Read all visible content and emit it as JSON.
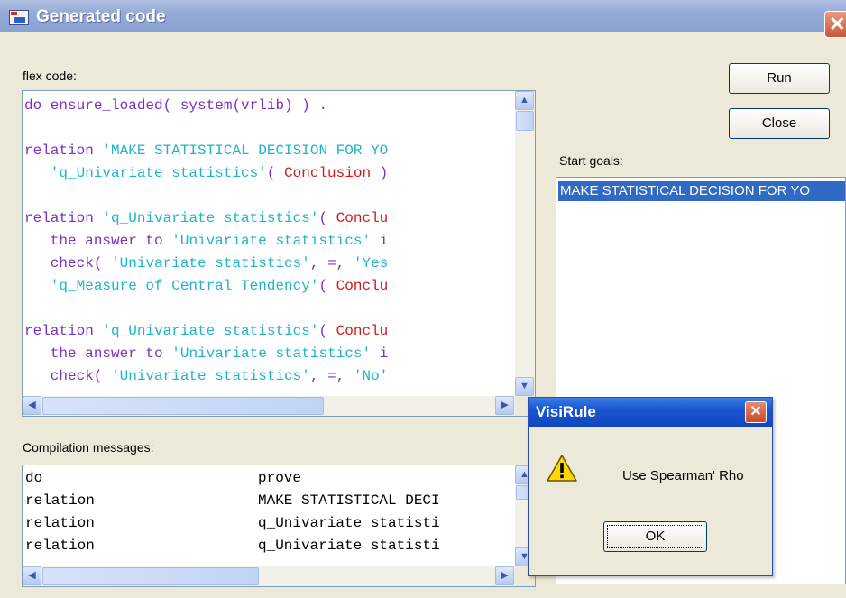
{
  "window": {
    "title": "Generated code",
    "close_glyph": "✕"
  },
  "labels": {
    "flex_code": "flex code:",
    "compilation_messages": "Compilation messages:",
    "start_goals": "Start goals:"
  },
  "buttons": {
    "run": "Run",
    "close": "Close"
  },
  "code_lines": [
    [
      {
        "t": "do ensure_loaded( system(vrlib) ) .",
        "c": "kw"
      }
    ],
    [],
    [
      {
        "t": "relation ",
        "c": "kw"
      },
      {
        "t": "'MAKE STATISTICAL DECISION FOR YO",
        "c": "str"
      }
    ],
    [
      {
        "t": "   'q_Univariate statistics'",
        "c": "str"
      },
      {
        "t": "( ",
        "c": "op"
      },
      {
        "t": "Conclusion",
        "c": "var"
      },
      {
        "t": " )",
        "c": "op"
      }
    ],
    [],
    [
      {
        "t": "relation ",
        "c": "kw"
      },
      {
        "t": "'q_Univariate statistics'",
        "c": "str"
      },
      {
        "t": "( ",
        "c": "op"
      },
      {
        "t": "Conclu",
        "c": "var"
      }
    ],
    [
      {
        "t": "   the answer to ",
        "c": "kw"
      },
      {
        "t": "'Univariate statistics'",
        "c": "str"
      },
      {
        "t": " i",
        "c": "kw"
      }
    ],
    [
      {
        "t": "   check( ",
        "c": "kw"
      },
      {
        "t": "'Univariate statistics'",
        "c": "str"
      },
      {
        "t": ", =, ",
        "c": "op"
      },
      {
        "t": "'Yes",
        "c": "str"
      }
    ],
    [
      {
        "t": "   'q_Measure of Central Tendency'",
        "c": "str"
      },
      {
        "t": "( ",
        "c": "op"
      },
      {
        "t": "Conclu",
        "c": "var"
      }
    ],
    [],
    [
      {
        "t": "relation ",
        "c": "kw"
      },
      {
        "t": "'q_Univariate statistics'",
        "c": "str"
      },
      {
        "t": "( ",
        "c": "op"
      },
      {
        "t": "Conclu",
        "c": "var"
      }
    ],
    [
      {
        "t": "   the answer to ",
        "c": "kw"
      },
      {
        "t": "'Univariate statistics'",
        "c": "str"
      },
      {
        "t": " i",
        "c": "kw"
      }
    ],
    [
      {
        "t": "   check( ",
        "c": "kw"
      },
      {
        "t": "'Univariate statistics'",
        "c": "str"
      },
      {
        "t": ", =, ",
        "c": "op"
      },
      {
        "t": "'No'",
        "c": "str"
      }
    ]
  ],
  "messages": [
    {
      "type": "do",
      "detail": "prove"
    },
    {
      "type": "relation",
      "detail": "MAKE STATISTICAL DECI"
    },
    {
      "type": "relation",
      "detail": "q_Univariate statisti"
    },
    {
      "type": "relation",
      "detail": "q_Univariate statisti"
    }
  ],
  "start_goals": [
    "MAKE STATISTICAL DECISION FOR YO"
  ],
  "dialog": {
    "title": "VisiRule",
    "message": "Use Spearman' Rho",
    "ok": "OK",
    "close_glyph": "✕"
  },
  "colors": {
    "keyword": "#7c2fc0",
    "string": "#1fb4c8",
    "variable": "#d11a1a",
    "selection": "#316ac5"
  }
}
